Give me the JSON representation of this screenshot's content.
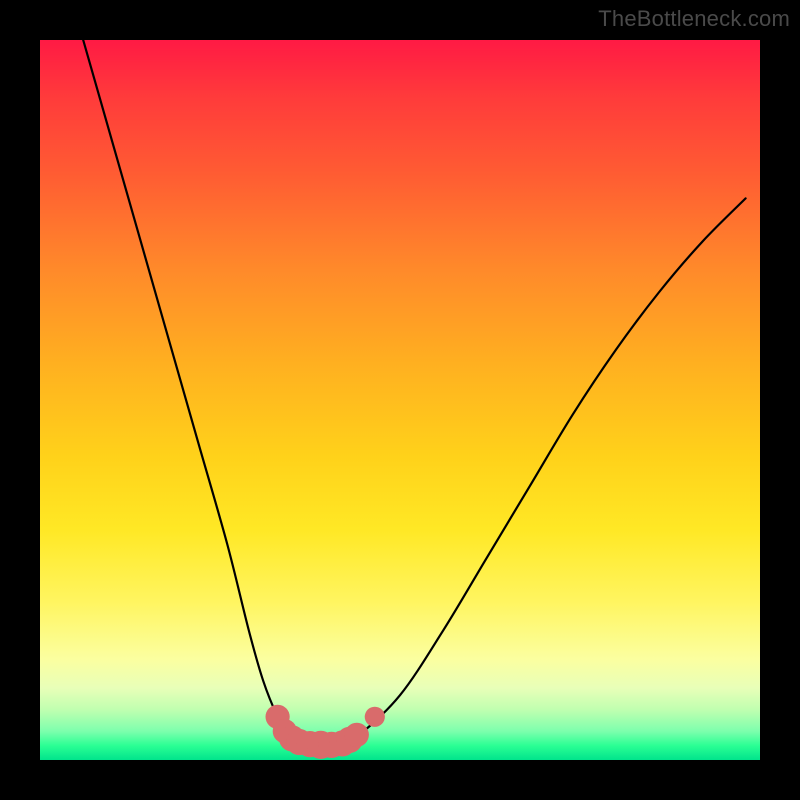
{
  "watermark": "TheBottleneck.com",
  "chart_data": {
    "type": "line",
    "title": "",
    "xlabel": "",
    "ylabel": "",
    "xlim": [
      0,
      100
    ],
    "ylim": [
      0,
      100
    ],
    "grid": false,
    "series": [
      {
        "name": "bottleneck-curve",
        "x": [
          6,
          10,
          14,
          18,
          22,
          26,
          29,
          31,
          33,
          34.5,
          36,
          38,
          40,
          42,
          44,
          50,
          56,
          62,
          68,
          74,
          80,
          86,
          92,
          98
        ],
        "y": [
          100,
          86,
          72,
          58,
          44,
          30,
          18,
          11,
          6,
          3.5,
          2.5,
          2.2,
          2.2,
          2.5,
          3.2,
          9,
          18,
          28,
          38,
          48,
          57,
          65,
          72,
          78
        ]
      }
    ],
    "markers": {
      "name": "highlight-points",
      "color": "#d96b6b",
      "points": [
        {
          "x": 33.0,
          "y": 6.0,
          "r": 1.2
        },
        {
          "x": 34.0,
          "y": 4.0,
          "r": 1.2
        },
        {
          "x": 35.0,
          "y": 3.0,
          "r": 1.3
        },
        {
          "x": 36.0,
          "y": 2.5,
          "r": 1.3
        },
        {
          "x": 37.5,
          "y": 2.2,
          "r": 1.3
        },
        {
          "x": 39.0,
          "y": 2.1,
          "r": 1.4
        },
        {
          "x": 40.5,
          "y": 2.1,
          "r": 1.3
        },
        {
          "x": 42.0,
          "y": 2.3,
          "r": 1.3
        },
        {
          "x": 43.0,
          "y": 2.8,
          "r": 1.3
        },
        {
          "x": 44.0,
          "y": 3.5,
          "r": 1.2
        },
        {
          "x": 46.5,
          "y": 6.0,
          "r": 1.0
        }
      ]
    }
  }
}
